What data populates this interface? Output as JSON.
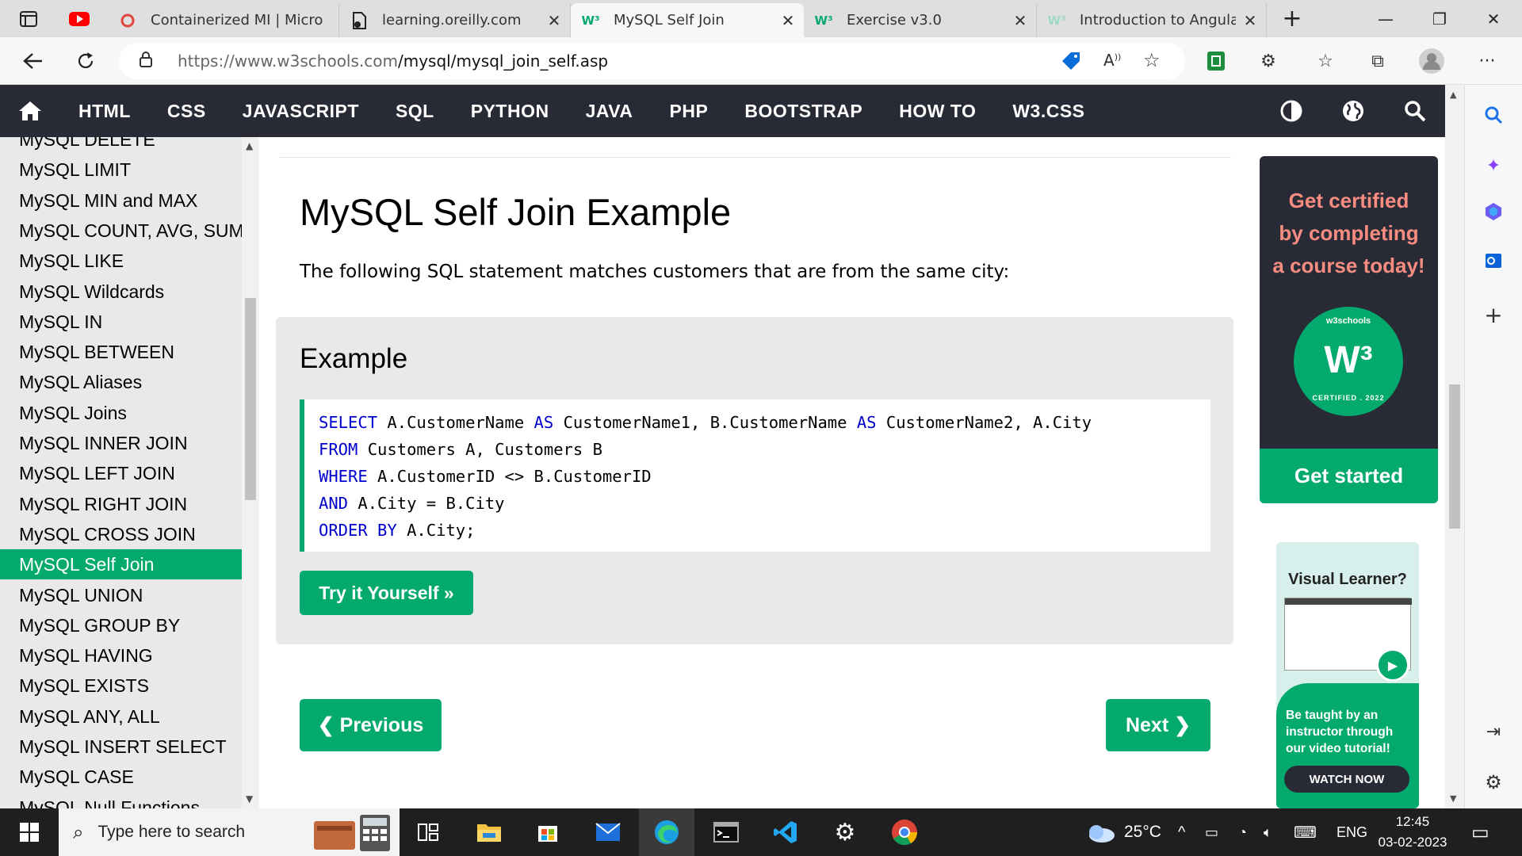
{
  "browser": {
    "tabs": [
      {
        "label": "Containerized MI | Micro",
        "favicon": "office-icon",
        "active": false
      },
      {
        "label": "learning.oreilly.com",
        "favicon": "page-icon",
        "active": false
      },
      {
        "label": "MySQL Self Join",
        "favicon": "w3schools-icon",
        "active": true
      },
      {
        "label": "Exercise v3.0",
        "favicon": "w3schools-icon",
        "active": false
      },
      {
        "label": "Introduction to AngularJ",
        "favicon": "w3schools-icon",
        "active": false
      }
    ],
    "url_host": "https://www.w3schools.com",
    "url_path": "/mysql/mysql_join_self.asp"
  },
  "w3nav": {
    "items": [
      "HTML",
      "CSS",
      "JAVASCRIPT",
      "SQL",
      "PYTHON",
      "JAVA",
      "PHP",
      "BOOTSTRAP",
      "HOW TO",
      "W3.CSS"
    ]
  },
  "sidebar": {
    "items": [
      "MySQL DELETE",
      "MySQL LIMIT",
      "MySQL MIN and MAX",
      "MySQL COUNT, AVG, SUM",
      "MySQL LIKE",
      "MySQL Wildcards",
      "MySQL IN",
      "MySQL BETWEEN",
      "MySQL Aliases",
      "MySQL Joins",
      "MySQL INNER JOIN",
      "MySQL LEFT JOIN",
      "MySQL RIGHT JOIN",
      "MySQL CROSS JOIN",
      "MySQL Self Join",
      "MySQL UNION",
      "MySQL GROUP BY",
      "MySQL HAVING",
      "MySQL EXISTS",
      "MySQL ANY, ALL",
      "MySQL INSERT SELECT",
      "MySQL CASE",
      "MySQL Null Functions"
    ],
    "active_index": 14
  },
  "main": {
    "title": "MySQL Self Join Example",
    "intro": "The following SQL statement matches customers that are from the same city:",
    "example_heading": "Example",
    "code": [
      [
        {
          "k": true,
          "t": "SELECT"
        },
        {
          "k": false,
          "t": " A.CustomerName "
        },
        {
          "k": true,
          "t": "AS"
        },
        {
          "k": false,
          "t": " CustomerName1, B.CustomerName "
        },
        {
          "k": true,
          "t": "AS"
        },
        {
          "k": false,
          "t": " CustomerName2, A.City"
        }
      ],
      [
        {
          "k": true,
          "t": "FROM"
        },
        {
          "k": false,
          "t": " Customers A, Customers B"
        }
      ],
      [
        {
          "k": true,
          "t": "WHERE"
        },
        {
          "k": false,
          "t": " A.CustomerID <> B.CustomerID"
        }
      ],
      [
        {
          "k": true,
          "t": "AND"
        },
        {
          "k": false,
          "t": " A.City = B.City"
        }
      ],
      [
        {
          "k": true,
          "t": "ORDER BY"
        },
        {
          "k": false,
          "t": " A.City;"
        }
      ]
    ],
    "try_label": "Try it Yourself »",
    "prev_label": "❮ Previous",
    "next_label": "Next ❯"
  },
  "ads": {
    "cert_text": [
      "Get certified",
      "by completing",
      "a course today!"
    ],
    "badge_top": "w3schools",
    "badge_w3": "W³",
    "badge_bottom": "CERTIFIED . 2022",
    "get_started": "Get started",
    "visual_title": "Visual Learner?",
    "visual_text": "Be taught by an instructor through our video tutorial!",
    "watch_now": "WATCH NOW"
  },
  "taskbar": {
    "search_placeholder": "Type here to search",
    "temperature": "25°C",
    "language": "ENG",
    "time": "12:45",
    "date": "03-02-2023"
  },
  "colors": {
    "w3_green": "#04aa6d",
    "w3_dark": "#282a35",
    "sidebar_bg": "#e7e9eb",
    "keyword_blue": "#0000cd",
    "cert_pink": "#f78c80"
  }
}
